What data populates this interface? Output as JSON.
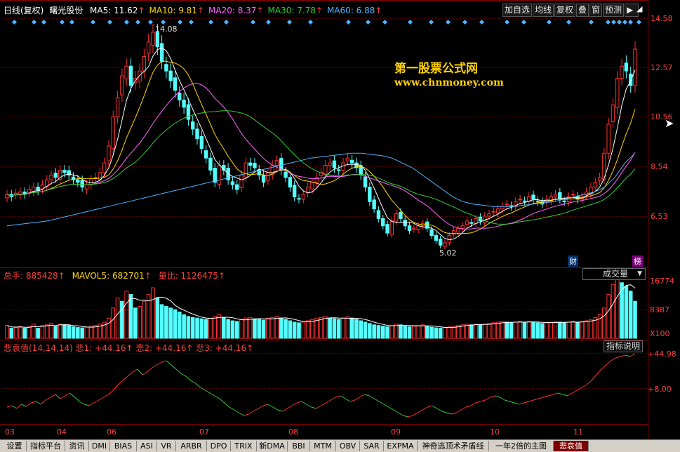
{
  "header": {
    "period": "日线(复权)",
    "stock_name": "曙光股份",
    "ma": [
      {
        "label": "MA5: 11.62",
        "color": "#ffffff"
      },
      {
        "label": "MA10: 9.81",
        "color": "#ffd700"
      },
      {
        "label": "MA20: 8.37",
        "color": "#ff66ff"
      },
      {
        "label": "MA30: 7.78",
        "color": "#33cc33"
      },
      {
        "label": "MA60: 6.88",
        "color": "#4fb3ff"
      }
    ],
    "arrow": "↑"
  },
  "toolbar": {
    "add_watch": "加自选",
    "ma_line": "均线",
    "restore": "复权",
    "overlay": "叠",
    "window": "窗",
    "forecast": "预测",
    "play": "▶"
  },
  "watermark": {
    "line1": "第一股票公式网",
    "line2": "www.chnmoney.com"
  },
  "price_axis": [
    "14.58",
    "12.57",
    "10.56",
    "8.54",
    "6.53"
  ],
  "price_annotations": {
    "high": "14.08",
    "low": "5.02"
  },
  "markers": {
    "cai": "财",
    "bang": "榜"
  },
  "volume": {
    "total_label": "总手: 885428",
    "mavol_label": "MAVOL5: 682701",
    "ratio_label": "量比: 1126475",
    "dropdown": "成交量",
    "axis": [
      "16774",
      "8387",
      "X100"
    ]
  },
  "indicator": {
    "title": "悲哀值(14,14,14)",
    "v1": "悲1: +44.16",
    "v2": "悲2: +44.16",
    "v3": "悲3: +44.16",
    "help_button": "指标说明",
    "axis_top": "+44.98",
    "axis_mid": "+8.00"
  },
  "months": [
    "03",
    "04",
    "06",
    "07",
    "08",
    "09",
    "10",
    "11"
  ],
  "tabs": [
    "设置",
    "指标平台",
    "资讯",
    "DMI",
    "BIAS",
    "ASI",
    "VR",
    "ARBR",
    "DPO",
    "TRIX",
    "新DMA",
    "BBI",
    "MTM",
    "OBV",
    "SAR",
    "EXPMA",
    "神奇逃顶术矛盾线",
    "一年2倍的主图",
    "悲哀值"
  ],
  "active_tab": "悲哀值",
  "colors": {
    "up": "#ff3030",
    "down": "#54ffff",
    "grid": "#8b0000",
    "axis_text": "#ff4040",
    "ma5": "#ffffff",
    "ma10": "#ffd700",
    "ma20": "#ff66ff",
    "ma30": "#33cc33",
    "ma60": "#4fb3ff"
  },
  "chart_data": {
    "type": "candlestick",
    "price_range": [
      4.6,
      14.58
    ],
    "close_series": [
      7.3,
      7.2,
      7.35,
      7.4,
      7.3,
      7.5,
      7.6,
      7.45,
      7.7,
      7.9,
      8.1,
      8.0,
      8.3,
      8.2,
      8.1,
      7.9,
      7.8,
      7.6,
      7.7,
      7.9,
      8.0,
      8.2,
      8.6,
      9.3,
      10.5,
      11.3,
      12.2,
      12.6,
      11.8,
      12.1,
      12.4,
      13.0,
      13.6,
      14.0,
      13.4,
      12.8,
      12.4,
      12.0,
      11.6,
      11.2,
      10.9,
      10.4,
      10.0,
      9.6,
      9.2,
      8.8,
      8.3,
      7.8,
      8.5,
      8.3,
      7.9,
      7.7,
      7.5,
      8.1,
      8.6,
      8.5,
      8.4,
      8.1,
      7.8,
      8.2,
      8.5,
      8.7,
      8.3,
      8.0,
      7.6,
      7.2,
      7.1,
      7.3,
      7.6,
      7.8,
      8.0,
      8.2,
      8.5,
      8.6,
      8.4,
      8.3,
      8.6,
      8.8,
      8.6,
      8.4,
      8.1,
      7.6,
      7.0,
      6.7,
      6.3,
      6.0,
      5.7,
      6.2,
      6.5,
      6.3,
      6.0,
      5.8,
      5.9,
      6.0,
      6.1,
      5.9,
      5.6,
      5.4,
      5.2,
      5.3,
      5.6,
      5.8,
      5.9,
      6.0,
      6.2,
      6.1,
      6.3,
      6.2,
      6.4,
      6.5,
      6.6,
      6.7,
      6.8,
      6.9,
      6.8,
      7.0,
      7.1,
      7.0,
      7.2,
      7.1,
      7.0,
      6.9,
      7.1,
      7.2,
      7.3,
      7.1,
      7.0,
      7.2,
      7.3,
      7.1,
      7.2,
      7.4,
      7.6,
      7.8,
      8.0,
      9.0,
      10.2,
      11.0,
      12.1,
      12.6,
      12.4,
      11.8,
      13.3
    ],
    "ma60_series": [
      6.0,
      6.05,
      6.1,
      6.15,
      6.2,
      6.3,
      6.4,
      6.5,
      6.6,
      6.7,
      6.8,
      6.9,
      7.0,
      7.1,
      7.2,
      7.3,
      7.4,
      7.5,
      7.6,
      7.7,
      7.8,
      7.9,
      8.0,
      8.1,
      8.2,
      8.3,
      8.4,
      8.5,
      8.6,
      8.7,
      8.8,
      8.85,
      8.9,
      8.95,
      9.0,
      9.0,
      8.95,
      8.9,
      8.8,
      8.6,
      8.4,
      8.1,
      7.8,
      7.5,
      7.2,
      7.0,
      6.9,
      6.85,
      6.8,
      6.8,
      6.8,
      6.85,
      6.9,
      6.95,
      7.0,
      7.1,
      7.2,
      7.3,
      7.4,
      7.6,
      8.0,
      8.6,
      9.0
    ],
    "volume_series": [
      380,
      300,
      320,
      350,
      300,
      360,
      420,
      300,
      380,
      400,
      450,
      350,
      420,
      400,
      380,
      340,
      320,
      310,
      330,
      360,
      380,
      420,
      480,
      600,
      900,
      1200,
      1100,
      1400,
      1300,
      900,
      950,
      1100,
      1300,
      1500,
      1200,
      1000,
      950,
      900,
      850,
      780,
      700,
      650,
      620,
      600,
      580,
      560,
      600,
      650,
      700,
      620,
      560,
      520,
      500,
      560,
      600,
      620,
      580,
      560,
      540,
      600,
      620,
      650,
      600,
      560,
      520,
      480,
      460,
      480,
      520,
      560,
      600,
      620,
      650,
      600,
      580,
      560,
      600,
      640,
      600,
      560,
      520,
      480,
      440,
      400,
      380,
      360,
      340,
      380,
      420,
      400,
      360,
      340,
      360,
      380,
      400,
      360,
      330,
      310,
      300,
      320,
      340,
      360,
      380,
      400,
      420,
      400,
      420,
      400,
      420,
      440,
      460,
      480,
      500,
      480,
      460,
      480,
      500,
      480,
      500,
      480,
      460,
      440,
      460,
      480,
      500,
      480,
      460,
      480,
      500,
      480,
      500,
      520,
      560,
      620,
      700,
      900,
      1300,
      1600,
      1750,
      1650,
      1550,
      1400,
      1100
    ],
    "indicator_series": [
      20,
      22,
      18,
      24,
      21,
      26,
      28,
      24,
      30,
      34,
      38,
      32,
      36,
      40,
      34,
      28,
      24,
      22,
      26,
      30,
      34,
      38,
      44,
      52,
      58,
      64,
      70,
      74,
      66,
      70,
      76,
      80,
      84,
      86,
      80,
      74,
      68,
      64,
      58,
      54,
      48,
      44,
      40,
      36,
      32,
      26,
      20,
      16,
      12,
      8,
      10,
      14,
      18,
      22,
      24,
      20,
      16,
      14,
      18,
      22,
      26,
      28,
      24,
      20,
      18,
      22,
      26,
      30,
      34,
      36,
      32,
      28,
      30,
      34,
      38,
      36,
      32,
      28,
      24,
      20,
      16,
      12,
      8,
      6,
      8,
      12,
      16,
      20,
      22,
      18,
      14,
      12,
      10,
      12,
      16,
      20,
      22,
      26,
      28,
      30,
      34,
      36,
      34,
      30,
      28,
      26,
      24,
      26,
      28,
      30,
      32,
      34,
      36,
      38,
      40,
      38,
      36,
      40,
      44,
      48,
      52,
      58,
      66,
      74,
      80,
      86,
      90,
      92,
      94,
      92,
      96
    ]
  }
}
